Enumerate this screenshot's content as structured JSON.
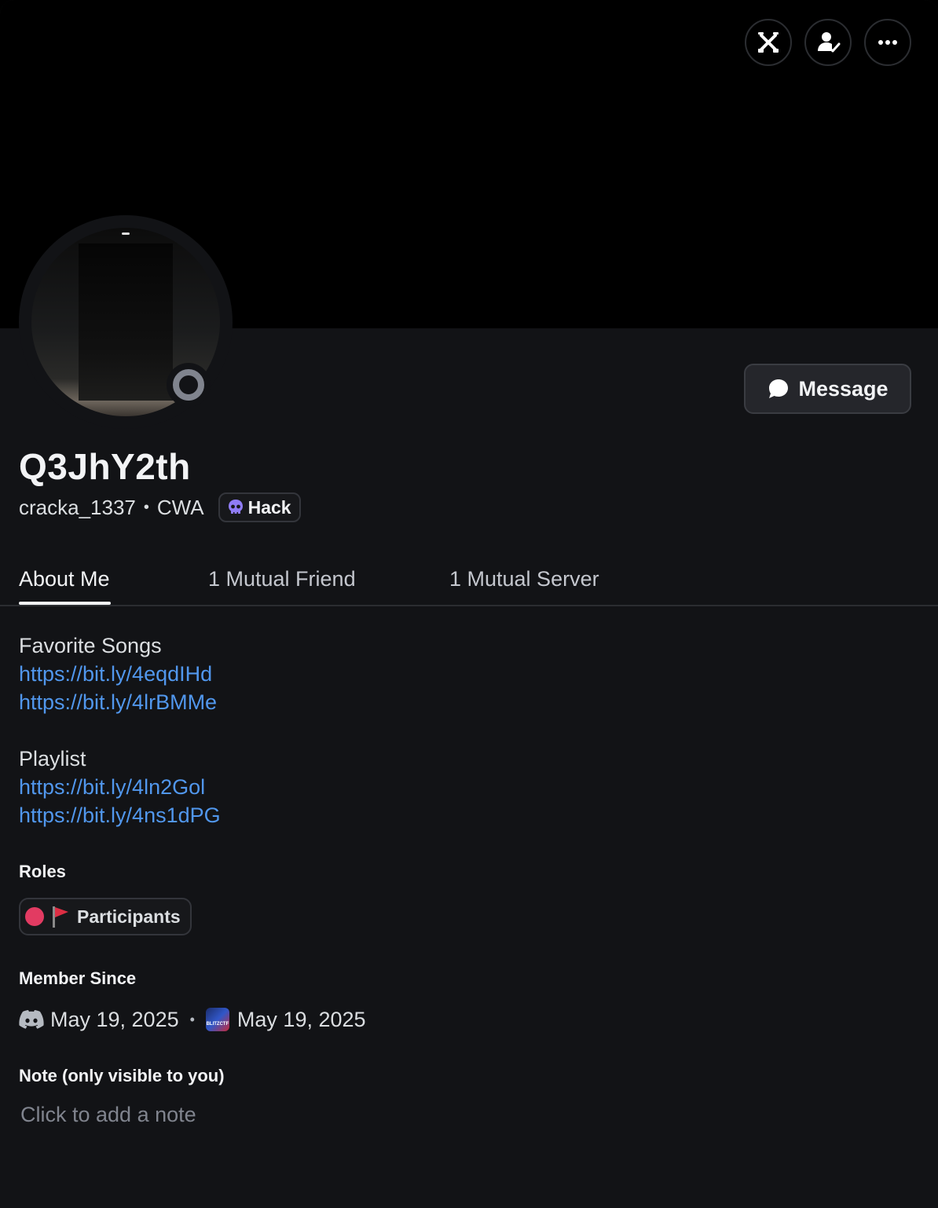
{
  "header": {
    "actions": [
      {
        "icon": "swords-icon",
        "label": ""
      },
      {
        "icon": "friend-check-icon",
        "label": ""
      },
      {
        "icon": "more-dots-icon",
        "label": ""
      }
    ]
  },
  "profile": {
    "display_name": "Q3JhY2th",
    "username": "cracka_1337",
    "separator": "•",
    "clan_label": "CWA",
    "tag_label": "Hack",
    "status": "offline",
    "message_button": "Message"
  },
  "tabs": [
    {
      "label": "About Me",
      "active": true
    },
    {
      "label": "1 Mutual Friend",
      "active": false
    },
    {
      "label": "1 Mutual Server",
      "active": false
    }
  ],
  "bio": {
    "heading1": "Favorite Songs",
    "links1": [
      "https://bit.ly/4eqdIHd",
      "https://bit.ly/4lrBMMe"
    ],
    "heading2": "Playlist",
    "links2": [
      "https://bit.ly/4ln2Gol",
      "https://bit.ly/4ns1dPG"
    ]
  },
  "roles": {
    "title": "Roles",
    "items": [
      {
        "label": "Participants",
        "color": "#e23b62"
      }
    ]
  },
  "member_since": {
    "title": "Member Since",
    "discord_date": "May 19, 2025",
    "separator": "•",
    "server_date": "May 19, 2025",
    "server_icon_text": "BLITZCTF"
  },
  "note": {
    "title": "Note (only visible to you)",
    "placeholder": "Click to add a note"
  },
  "colors": {
    "background": "#121316",
    "banner": "#000000",
    "link": "#5197ed",
    "status_offline": "#80848e",
    "role": "#e23b62"
  }
}
